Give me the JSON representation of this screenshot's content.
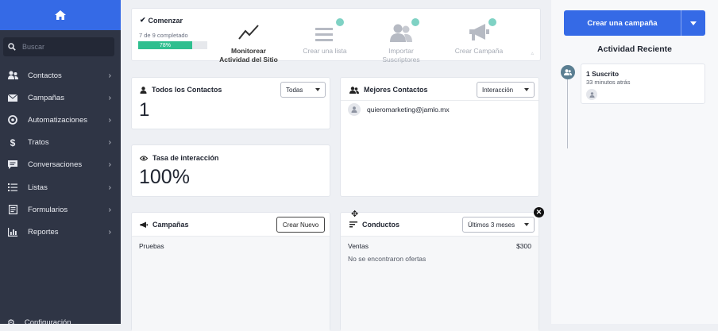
{
  "sidebar": {
    "search_placeholder": "Buscar",
    "items": [
      {
        "label": "Contactos",
        "icon": "contacts-icon"
      },
      {
        "label": "Campañas",
        "icon": "envelope-icon"
      },
      {
        "label": "Automatizaciones",
        "icon": "automation-icon"
      },
      {
        "label": "Tratos",
        "icon": "dollar-icon"
      },
      {
        "label": "Conversaciones",
        "icon": "chat-icon"
      },
      {
        "label": "Listas",
        "icon": "list-icon"
      },
      {
        "label": "Formularios",
        "icon": "form-icon"
      },
      {
        "label": "Reportes",
        "icon": "chart-icon"
      }
    ],
    "settings_label": "Configuración"
  },
  "getting_started": {
    "title": "Comenzar",
    "progress_text": "7 de 9 completado",
    "progress_percent": "78%",
    "progress_value": 0.78,
    "steps": [
      {
        "label_line1": "Monitorear",
        "label_line2": "Actividad del Sitio",
        "done": false
      },
      {
        "label_line1": "Crear una lista",
        "label_line2": "",
        "done": true
      },
      {
        "label_line1": "Importar",
        "label_line2": "Suscriptores",
        "done": true
      },
      {
        "label_line1": "Crear Campaña",
        "label_line2": "",
        "done": true
      }
    ]
  },
  "all_contacts": {
    "title": "Todos los Contactos",
    "filter": "Todas",
    "value": "1"
  },
  "engagement": {
    "title": "Tasa de interacción",
    "value": "100%"
  },
  "top_contacts": {
    "title": "Mejores Contactos",
    "filter": "Interacción",
    "contacts": [
      "quieromarketing@jamlo.mx"
    ]
  },
  "campaigns": {
    "title": "Campañas",
    "button": "Crear Nuevo",
    "items": [
      "Pruebas"
    ]
  },
  "deals": {
    "title": "Conductos",
    "filter": "Últimos 3 meses",
    "row_label": "Ventas",
    "row_value": "$300",
    "empty_text": "No se encontraron ofertas"
  },
  "right_panel": {
    "cta_label": "Crear una campaña",
    "activity_title": "Actividad Reciente",
    "activity": {
      "title": "1 Suscrito",
      "time": "33 minutos atrás"
    }
  }
}
